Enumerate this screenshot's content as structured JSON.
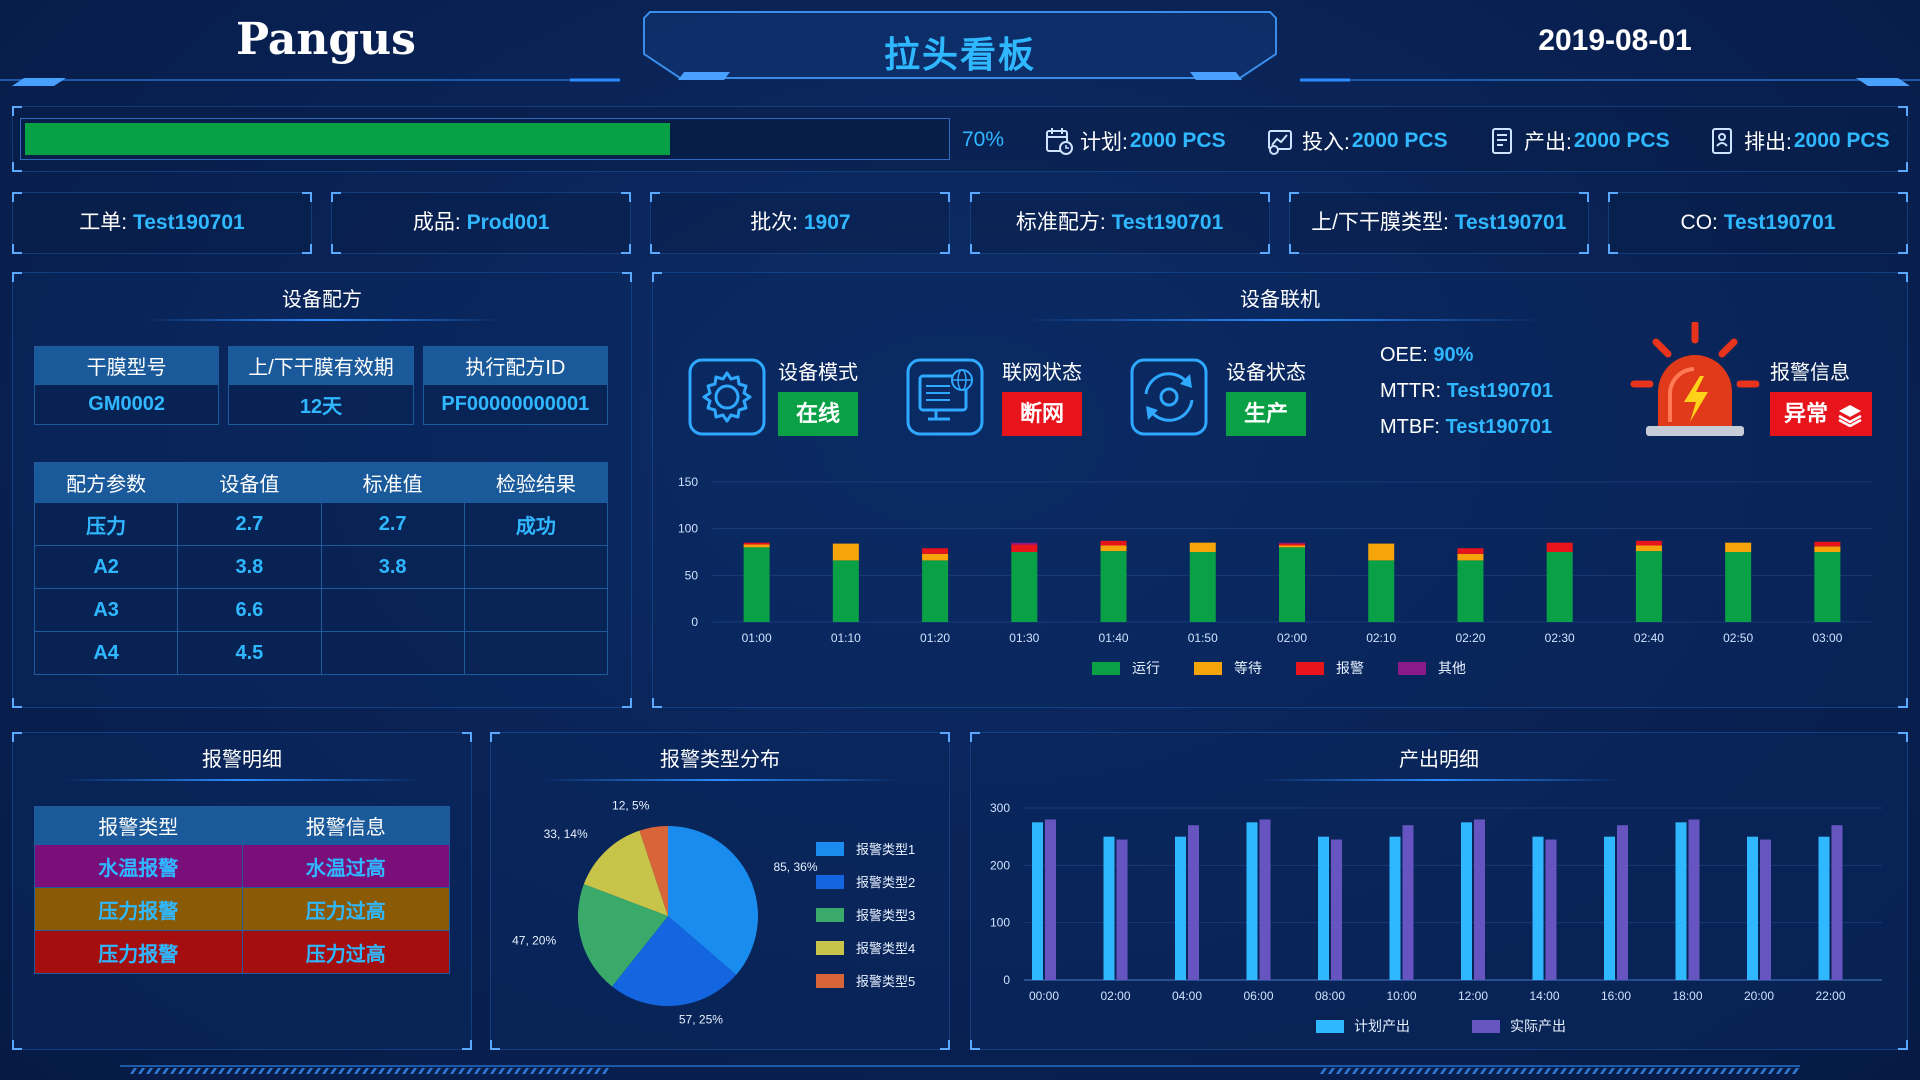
{
  "header": {
    "logo": "Pangus",
    "title": "拉头看板",
    "date": "2019-08-01"
  },
  "progress": {
    "fraction": 0.7,
    "percent_label": "70%",
    "fill_color": "#06a145"
  },
  "stats": {
    "plan_label": "计划:",
    "plan_value": "2000 PCS",
    "input_label": "投入:",
    "input_value": "2000 PCS",
    "output_label": "产出:",
    "output_value": "2000 PCS",
    "discharge_label": "排出:",
    "discharge_value": "2000 PCS"
  },
  "info": [
    {
      "label": "工单:",
      "value": "Test190701"
    },
    {
      "label": "成品:",
      "value": "Prod001"
    },
    {
      "label": "批次:",
      "value": "1907"
    },
    {
      "label": "标准配方:",
      "value": "Test190701"
    },
    {
      "label": "上/下干膜类型:",
      "value": "Test190701"
    },
    {
      "label": "CO:",
      "value": "Test190701"
    }
  ],
  "recipe": {
    "title": "设备配方",
    "head_cols": [
      "干膜型号",
      "上/下干膜有效期",
      "执行配方ID"
    ],
    "head_vals": [
      "GM0002",
      "12天",
      "PF00000000001"
    ],
    "param_cols": [
      "配方参数",
      "设备值",
      "标准值",
      "检验结果"
    ],
    "rows": [
      [
        "压力",
        "2.7",
        "2.7",
        "成功"
      ],
      [
        "A2",
        "3.8",
        "3.8",
        ""
      ],
      [
        "A3",
        "6.6",
        "",
        ""
      ],
      [
        "A4",
        "4.5",
        "",
        ""
      ]
    ]
  },
  "online": {
    "title": "设备联机",
    "mode_label": "设备模式",
    "mode_value": "在线",
    "net_label": "联网状态",
    "net_value": "断网",
    "state_label": "设备状态",
    "state_value": "生产",
    "oee_label": "OEE:",
    "oee_value": "90%",
    "mttr_label": "MTTR:",
    "mttr_value": "Test190701",
    "mtbf_label": "MTBF:",
    "mtbf_value": "Test190701",
    "alarm_label": "报警信息",
    "alarm_value": "异常",
    "colors": {
      "green": "#0aa045",
      "red": "#e8141c"
    }
  },
  "alarm_detail": {
    "title": "报警明细",
    "cols": [
      "报警类型",
      "报警信息"
    ],
    "rows": [
      {
        "type": "水温报警",
        "info": "水温过高",
        "bg": "#7a0f7a"
      },
      {
        "type": "压力报警",
        "info": "压力过高",
        "bg": "#8a5a05"
      },
      {
        "type": "压力报警",
        "info": "压力过高",
        "bg": "#a50e0e"
      }
    ]
  },
  "alarm_type_dist": {
    "title": "报警类型分布"
  },
  "output_detail": {
    "title": "产出明细"
  },
  "chart_data": [
    {
      "type": "bar",
      "stacked": true,
      "categories": [
        "01:00",
        "01:10",
        "01:20",
        "01:30",
        "01:40",
        "01:50",
        "02:00",
        "02:10",
        "02:20",
        "02:30",
        "02:40",
        "02:50",
        "03:00"
      ],
      "series": [
        {
          "name": "运行",
          "color": "#0aa045",
          "values": [
            80,
            66,
            66,
            75,
            76,
            75,
            80,
            66,
            66,
            75,
            76,
            75,
            75
          ]
        },
        {
          "name": "等待",
          "color": "#f5a40a",
          "values": [
            3,
            18,
            7,
            0,
            6,
            10,
            2,
            18,
            7,
            0,
            6,
            10,
            6
          ]
        },
        {
          "name": "报警",
          "color": "#e8141c",
          "values": [
            2,
            0,
            6,
            8,
            5,
            0,
            2,
            0,
            6,
            10,
            5,
            0,
            5
          ]
        },
        {
          "name": "其他",
          "color": "#8a1a8a",
          "values": [
            0,
            0,
            0,
            2,
            0,
            0,
            1,
            0,
            0,
            0,
            0,
            0,
            0
          ]
        }
      ],
      "ylim": [
        0,
        150
      ],
      "yticks": [
        0,
        50,
        100,
        150
      ],
      "legend": "bottom"
    },
    {
      "type": "pie",
      "slices": [
        {
          "name": "报警类型1",
          "value": 85,
          "label": "85, 36%",
          "color": "#1a8cf0"
        },
        {
          "name": "报警类型2",
          "value": 57,
          "label": "57, 25%",
          "color": "#1465e0"
        },
        {
          "name": "报警类型3",
          "value": 47,
          "label": "47, 20%",
          "color": "#3aaa6a"
        },
        {
          "name": "报警类型4",
          "value": 33,
          "label": "33, 14%",
          "color": "#c8c44a"
        },
        {
          "name": "报警类型5",
          "value": 12,
          "label": "12, 5%",
          "color": "#d8643a"
        }
      ],
      "legend": "right"
    },
    {
      "type": "bar",
      "categories": [
        "00:00",
        "02:00",
        "04:00",
        "06:00",
        "08:00",
        "10:00",
        "12:00",
        "14:00",
        "16:00",
        "18:00",
        "20:00",
        "22:00"
      ],
      "series": [
        {
          "name": "计划产出",
          "color": "#2fb8ff",
          "values": [
            275,
            250,
            250,
            275,
            250,
            250,
            275,
            250,
            250,
            275,
            250,
            250
          ]
        },
        {
          "name": "实际产出",
          "color": "#6655c0",
          "values": [
            280,
            245,
            270,
            280,
            245,
            270,
            280,
            245,
            270,
            280,
            245,
            270
          ]
        }
      ],
      "ylim": [
        0,
        300
      ],
      "yticks": [
        0,
        100,
        200,
        300
      ],
      "legend": "bottom"
    }
  ]
}
